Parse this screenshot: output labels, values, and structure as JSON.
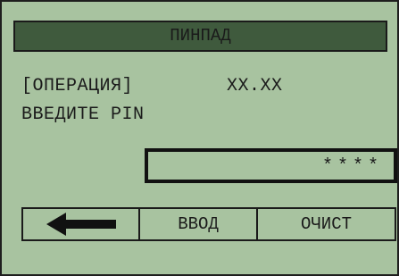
{
  "header": {
    "title": "ПИНПАД"
  },
  "transaction": {
    "operation_label": "[ОПЕРАЦИЯ]",
    "amount": "XX.XX"
  },
  "prompt": {
    "text": "ВВЕДИТЕ PIN"
  },
  "pin_field": {
    "value": "****"
  },
  "buttons": {
    "back_icon": "left-arrow-icon",
    "enter_label": "ВВОД",
    "clear_label": "ОЧИСТ"
  },
  "colors": {
    "screen_background": "#a8c3a0",
    "title_bar_background": "#3f5a3d",
    "text": "#1a1a1a"
  }
}
